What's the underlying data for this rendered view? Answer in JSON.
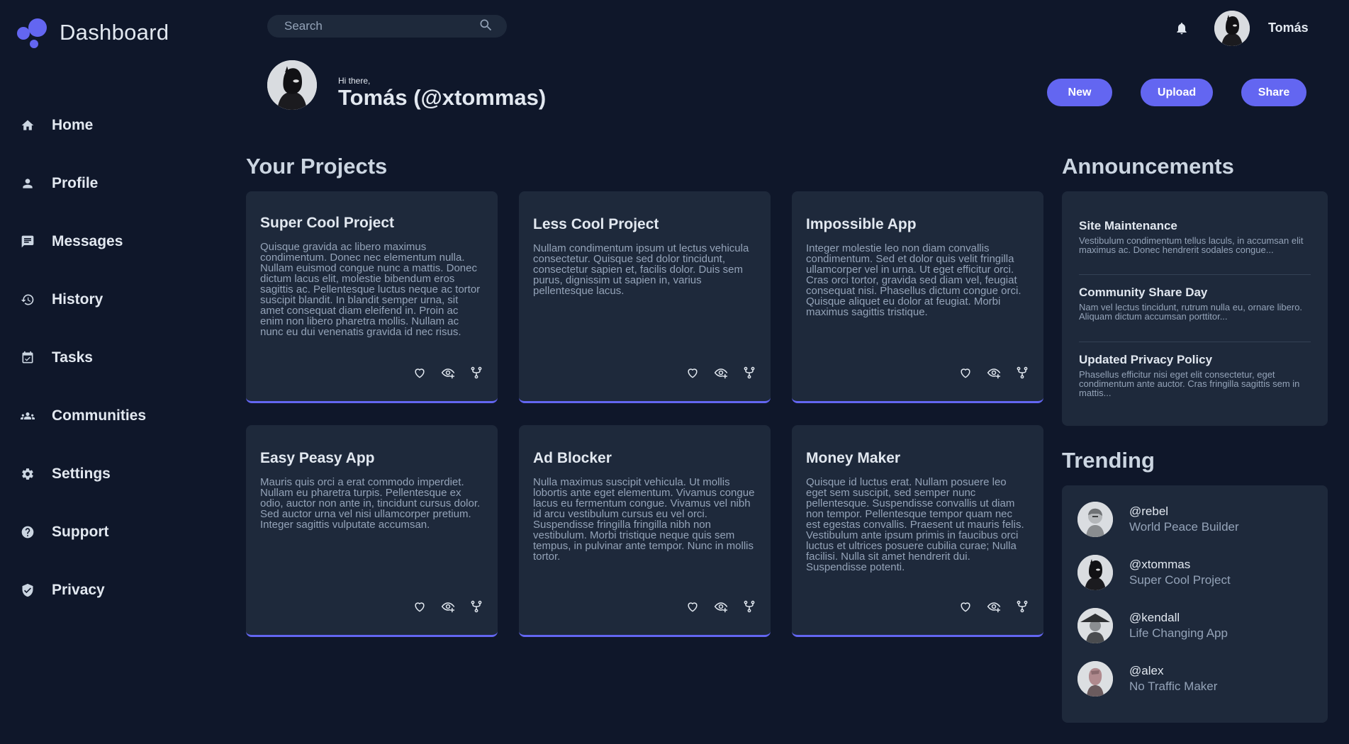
{
  "app": {
    "title": "Dashboard"
  },
  "sidebar": {
    "items": [
      {
        "label": "Home",
        "icon": "home-icon"
      },
      {
        "label": "Profile",
        "icon": "person-icon"
      },
      {
        "label": "Messages",
        "icon": "message-icon"
      },
      {
        "label": "History",
        "icon": "history-icon"
      },
      {
        "label": "Tasks",
        "icon": "calendar-check-icon"
      },
      {
        "label": "Communities",
        "icon": "group-icon"
      },
      {
        "label": "Settings",
        "icon": "gear-icon"
      },
      {
        "label": "Support",
        "icon": "help-icon"
      },
      {
        "label": "Privacy",
        "icon": "shield-check-icon"
      }
    ]
  },
  "search": {
    "placeholder": "Search",
    "value": ""
  },
  "topbar": {
    "username": "Tomás"
  },
  "greeting": {
    "hi": "Hi there,",
    "name": "Tomás (@xtommas)"
  },
  "actions": {
    "new": "New",
    "upload": "Upload",
    "share": "Share"
  },
  "projects": {
    "heading": "Your Projects",
    "items": [
      {
        "title": "Super Cool Project",
        "desc": "Quisque gravida ac libero maximus condimentum. Donec nec elementum nulla. Nullam euismod congue nunc a mattis. Donec dictum lacus elit, molestie bibendum eros sagittis ac. Pellentesque luctus neque ac tortor suscipit blandit. In blandit semper urna, sit amet consequat diam eleifend in. Proin ac enim non libero pharetra mollis. Nullam ac nunc eu dui venenatis gravida id nec risus."
      },
      {
        "title": "Less Cool Project",
        "desc": "Nullam condimentum ipsum ut lectus vehicula consectetur. Quisque sed dolor tincidunt, consectetur sapien et, facilis dolor. Duis sem purus, dignissim ut sapien in, varius pellentesque lacus."
      },
      {
        "title": "Impossible App",
        "desc": "Integer molestie leo non diam convallis condimentum. Sed et dolor quis velit fringilla ullamcorper vel in urna. Ut eget efficitur orci. Cras orci tortor, gravida sed diam vel, feugiat consequat nisi. Phasellus dictum congue orci. Quisque aliquet eu dolor at feugiat. Morbi maximus sagittis tristique."
      },
      {
        "title": "Easy Peasy App",
        "desc": "Mauris quis orci a erat commodo imperdiet. Nullam eu pharetra turpis. Pellentesque ex odio, auctor non ante in, tincidunt cursus dolor. Sed auctor urna vel nisi ullamcorper pretium. Integer sagittis vulputate accumsan."
      },
      {
        "title": "Ad Blocker",
        "desc": "Nulla maximus suscipit vehicula. Ut mollis lobortis ante eget elementum. Vivamus congue lacus eu fermentum congue. Vivamus vel nibh id arcu vestibulum cursus eu vel orci. Suspendisse fringilla fringilla nibh non vestibulum. Morbi tristique neque quis sem tempus, in pulvinar ante tempor. Nunc in mollis tortor."
      },
      {
        "title": "Money Maker",
        "desc": "Quisque id luctus erat. Nullam posuere leo eget sem suscipit, sed semper nunc pellentesque. Suspendisse convallis ut diam non tempor. Pellentesque tempor quam nec est egestas convallis. Praesent ut mauris felis. Vestibulum ante ipsum primis in faucibus orci luctus et ultrices posuere cubilia curae; Nulla facilisi. Nulla sit amet hendrerit dui. Suspendisse potenti."
      }
    ]
  },
  "announcements": {
    "heading": "Announcements",
    "items": [
      {
        "title": "Site Maintenance",
        "text": "Vestibulum condimentum tellus laculs, in accumsan elit maximus ac. Donec hendrerit sodales congue..."
      },
      {
        "title": "Community Share Day",
        "text": "Nam vel lectus tincidunt, rutrum nulla eu, ornare libero. Aliquam dictum accumsan porttitor..."
      },
      {
        "title": "Updated Privacy Policy",
        "text": "Phasellus efficitur nisi eget elit consectetur, eget condimentum ante auctor. Cras fringilla sagittis sem in mattis..."
      }
    ]
  },
  "trending": {
    "heading": "Trending",
    "items": [
      {
        "handle": "@rebel",
        "subtitle": "World Peace Builder"
      },
      {
        "handle": "@xtommas",
        "subtitle": "Super Cool Project"
      },
      {
        "handle": "@kendall",
        "subtitle": "Life Changing App"
      },
      {
        "handle": "@alex",
        "subtitle": "No Traffic Maker"
      }
    ]
  },
  "colors": {
    "background": "#0f172a",
    "panel": "#1e293b",
    "accent": "#6366f1",
    "text": "#e2e8f0",
    "muted": "#94a3b8"
  }
}
